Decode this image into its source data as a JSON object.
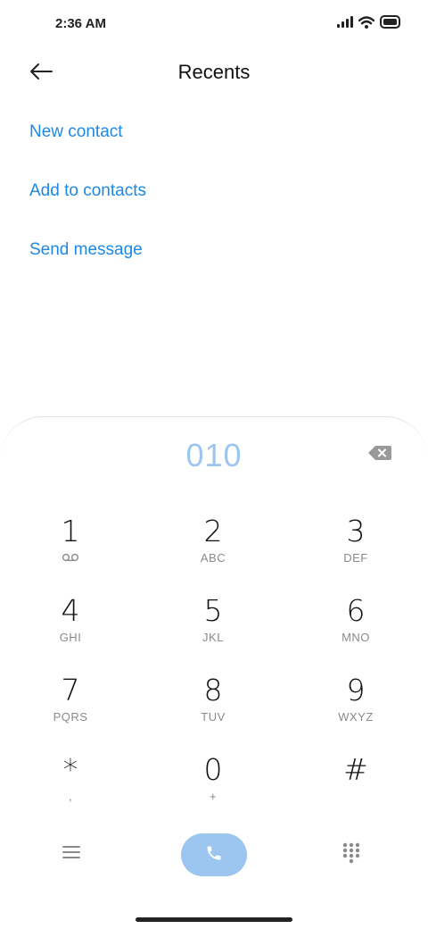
{
  "status_bar": {
    "time": "2:36 AM",
    "icons": [
      "signal-icon",
      "wifi-icon",
      "battery-icon"
    ]
  },
  "header": {
    "title": "Recents",
    "back_icon": "back-arrow-icon"
  },
  "actions": [
    {
      "label": "New contact"
    },
    {
      "label": "Add to contacts"
    },
    {
      "label": "Send message"
    }
  ],
  "dialer": {
    "number": "010",
    "keys": [
      {
        "digit": "1",
        "letters": ""
      },
      {
        "digit": "2",
        "letters": "ABC"
      },
      {
        "digit": "3",
        "letters": "DEF"
      },
      {
        "digit": "4",
        "letters": "GHI"
      },
      {
        "digit": "5",
        "letters": "JKL"
      },
      {
        "digit": "6",
        "letters": "MNO"
      },
      {
        "digit": "7",
        "letters": "PQRS"
      },
      {
        "digit": "8",
        "letters": "TUV"
      },
      {
        "digit": "9",
        "letters": "WXYZ"
      },
      {
        "digit": "*",
        "letters": ","
      },
      {
        "digit": "0",
        "letters": "+"
      },
      {
        "digit": "#",
        "letters": ""
      }
    ]
  },
  "colors": {
    "accent": "#1e88e5",
    "call_button": "#9cc6ef",
    "dialed_number": "#9cc6ef"
  }
}
